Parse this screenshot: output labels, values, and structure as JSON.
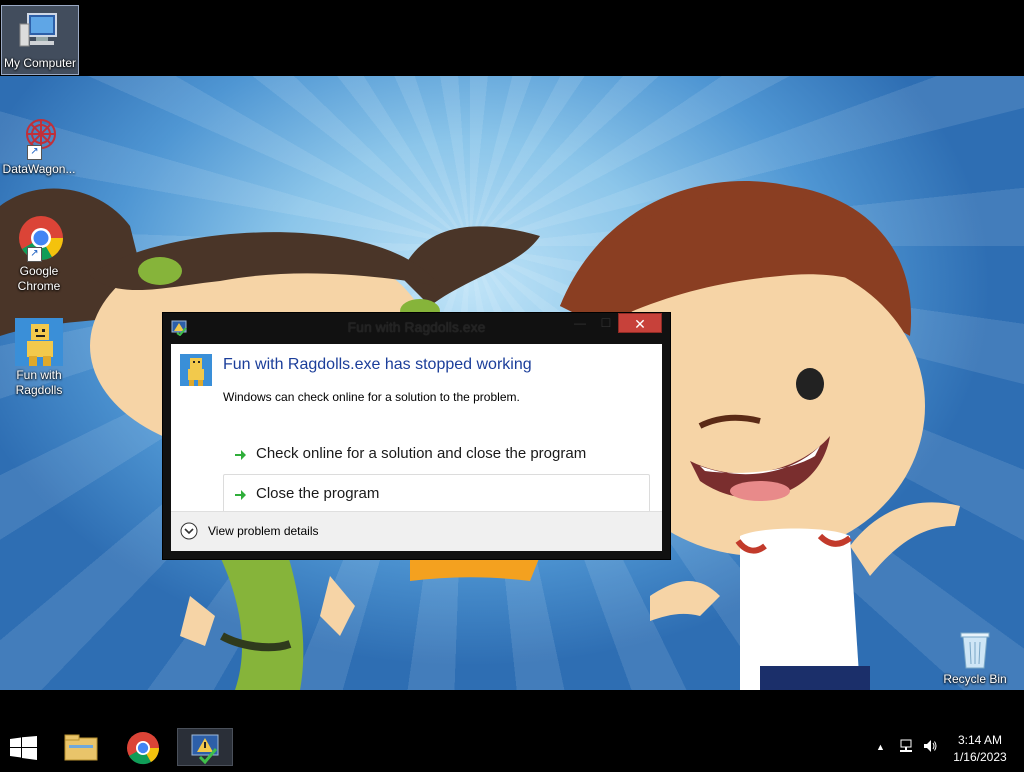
{
  "desktop": {
    "icons": [
      {
        "label": "My Computer"
      },
      {
        "label": "DataWagon..."
      },
      {
        "label": "Google Chrome"
      },
      {
        "label": "Fun with Ragdolls"
      },
      {
        "label": "Recycle Bin"
      }
    ]
  },
  "dialog": {
    "title": "Fun with Ragdolls.exe",
    "main_instruction": "Fun with Ragdolls.exe has stopped working",
    "sub_instruction": "Windows can check online for a solution to the problem.",
    "commands": [
      {
        "label": "Check online for a solution and close the program"
      },
      {
        "label": "Close the program"
      }
    ],
    "details_label": "View problem details",
    "close_glyph": "✕",
    "minimize_glyph": "—",
    "maximize_glyph": "☐"
  },
  "taskbar": {
    "pinned": [
      "start-icon",
      "file-explorer-icon",
      "chrome-icon",
      "error-reporting-icon"
    ],
    "time": "3:14 AM",
    "date": "1/16/2023",
    "tray_chevron": "▲"
  },
  "colors": {
    "accent_close": "#c7413a",
    "instruction_blue": "#1b3e9a",
    "arrow_green": "#2fae3a"
  }
}
